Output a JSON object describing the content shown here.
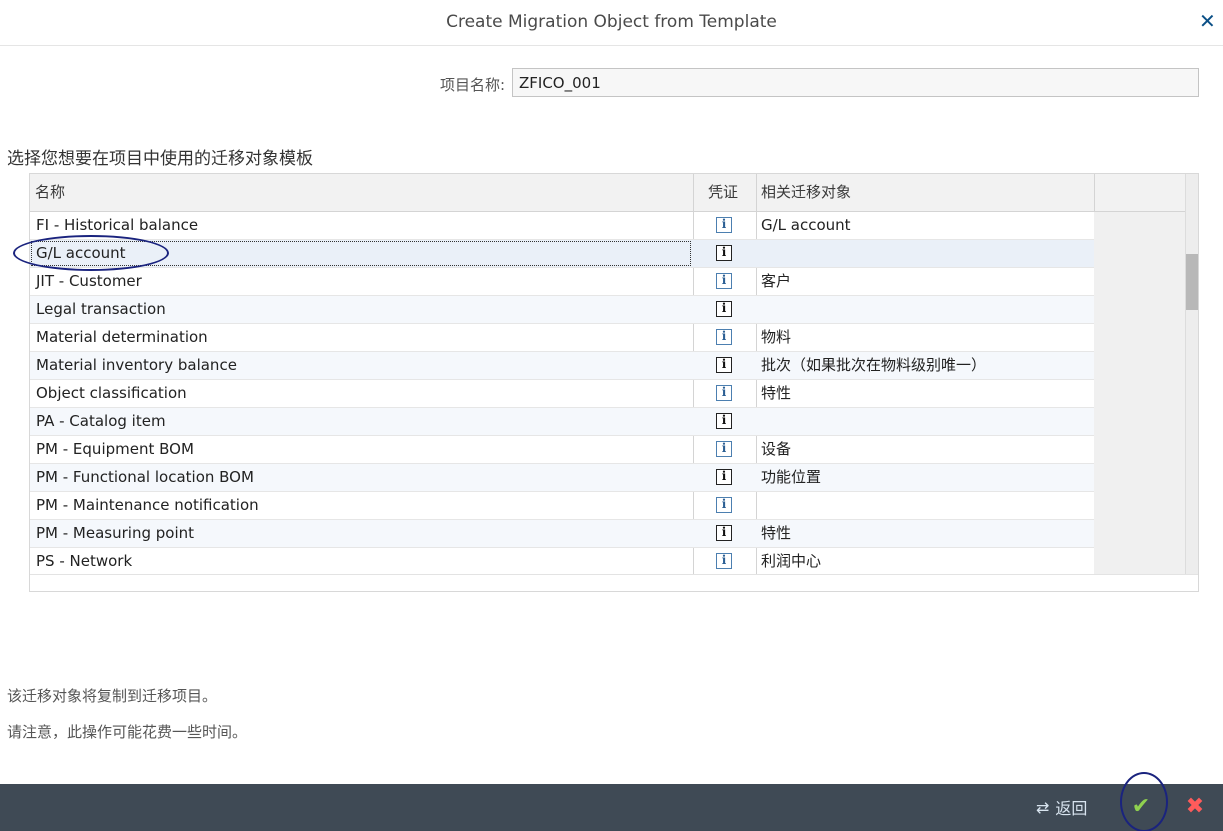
{
  "dialog": {
    "title": "Create Migration Object from Template",
    "close_icon": "close-icon"
  },
  "project": {
    "label": "项目名称:",
    "value": "ZFICO_001"
  },
  "section_title": "选择您想要在项目中使用的迁移对象模板",
  "table": {
    "headers": {
      "name": "名称",
      "doc": "凭证",
      "related": "相关迁移对象"
    },
    "rows": [
      {
        "name": "FI - Historical balance",
        "related": "G/L account",
        "info_icon": "info-icon"
      },
      {
        "name": "G/L account",
        "related": "",
        "info_icon": "info-icon",
        "selected": true
      },
      {
        "name": "JIT - Customer",
        "related": "客户",
        "info_icon": "info-icon"
      },
      {
        "name": "Legal transaction",
        "related": "",
        "info_icon": "info-icon"
      },
      {
        "name": "Material determination",
        "related": "物料",
        "info_icon": "info-icon"
      },
      {
        "name": "Material inventory balance",
        "related": "批次（如果批次在物料级别唯一）",
        "info_icon": "info-icon"
      },
      {
        "name": "Object classification",
        "related": "特性",
        "info_icon": "info-icon"
      },
      {
        "name": "PA - Catalog item",
        "related": "",
        "info_icon": "info-icon"
      },
      {
        "name": "PM - Equipment BOM",
        "related": "设备",
        "info_icon": "info-icon"
      },
      {
        "name": "PM - Functional location BOM",
        "related": "功能位置",
        "info_icon": "info-icon"
      },
      {
        "name": "PM - Maintenance notification",
        "related": "",
        "info_icon": "info-icon"
      },
      {
        "name": "PM - Measuring point",
        "related": "特性",
        "info_icon": "info-icon"
      },
      {
        "name": "PS - Network",
        "related": "利润中心",
        "info_icon": "info-icon"
      }
    ]
  },
  "notes": {
    "line1": "该迁移对象将复制到迁移项目。",
    "line2": "请注意，此操作可能花费一些时间。"
  },
  "footer": {
    "back_label": "返回",
    "back_icon": "back-icon",
    "ok_icon": "checkmark-icon",
    "cancel_icon": "cancel-icon"
  },
  "colors": {
    "footer_bg": "#3f4a55",
    "ok_green": "#8fd14f",
    "cancel_red": "#ff5b5b",
    "annotation": "#1a237e"
  }
}
